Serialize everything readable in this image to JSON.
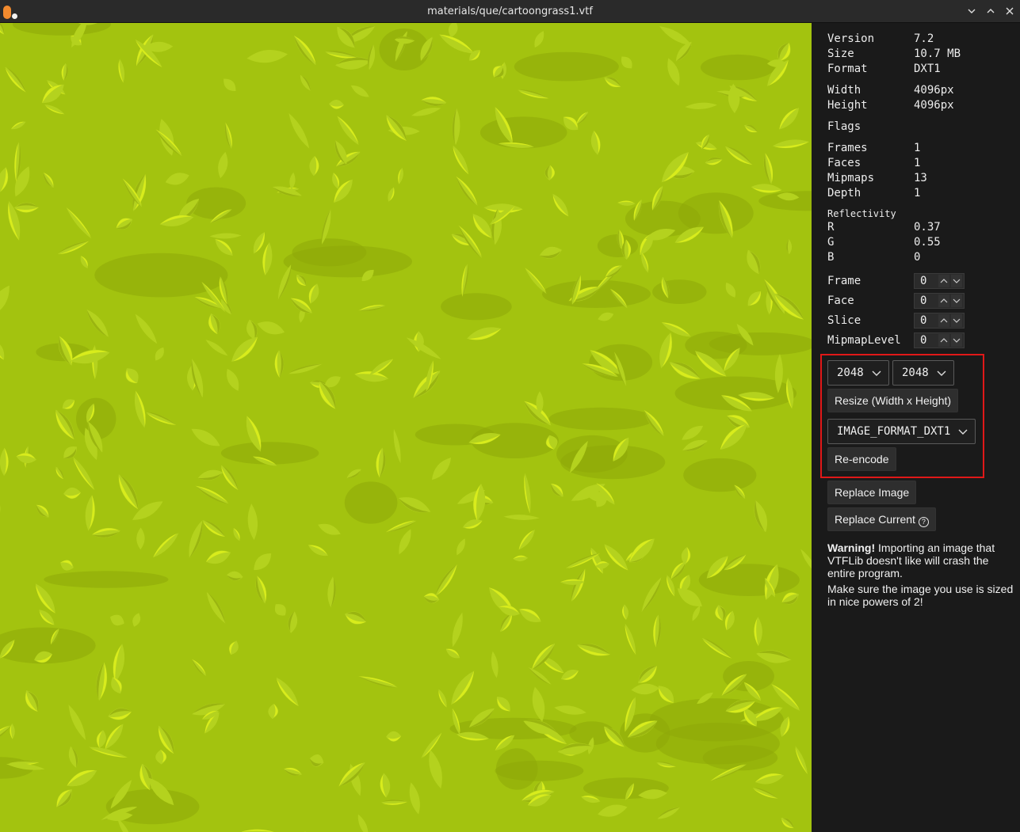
{
  "window": {
    "title": "materials/que/cartoongrass1.vtf"
  },
  "info": {
    "version": {
      "label": "Version",
      "value": "7.2"
    },
    "size": {
      "label": "Size",
      "value": "10.7 MB"
    },
    "format": {
      "label": "Format",
      "value": "DXT1"
    },
    "width": {
      "label": "Width",
      "value": "4096px"
    },
    "height": {
      "label": "Height",
      "value": "4096px"
    },
    "flags": {
      "label": "Flags"
    },
    "frames": {
      "label": "Frames",
      "value": "1"
    },
    "faces": {
      "label": "Faces",
      "value": "1"
    },
    "mipmaps": {
      "label": "Mipmaps",
      "value": "13"
    },
    "depth": {
      "label": "Depth",
      "value": "1"
    },
    "reflectivity_header": "Reflectivity",
    "r": {
      "label": "R",
      "value": "0.37"
    },
    "g": {
      "label": "G",
      "value": "0.55"
    },
    "b": {
      "label": "B",
      "value": "0"
    }
  },
  "controls": {
    "frame": {
      "label": "Frame",
      "value": "0"
    },
    "face": {
      "label": "Face",
      "value": "0"
    },
    "slice": {
      "label": "Slice",
      "value": "0"
    },
    "mipmap_level": {
      "label": "MipmapLevel",
      "value": "0"
    }
  },
  "resize": {
    "width_select": "2048",
    "height_select": "2048",
    "button": "Resize (Width x Height)"
  },
  "reencode": {
    "format_select": "IMAGE_FORMAT_DXT1",
    "button": "Re-encode"
  },
  "replace": {
    "replace_image": "Replace Image",
    "replace_current": "Replace Current"
  },
  "warning": {
    "bold": "Warning!",
    "text": " Importing an image that VTFLib doesn't like will crash the entire program.",
    "text2": "Make sure the image you use is sized in nice powers of 2!"
  },
  "colors": {
    "texture_base": "#a3c30f",
    "leaf": "#b4d21e",
    "highlight": "#d8ec1c",
    "shadow": "#8ea80a",
    "selection_outline": "#e01818",
    "logo_orange": "#f28a2e"
  }
}
